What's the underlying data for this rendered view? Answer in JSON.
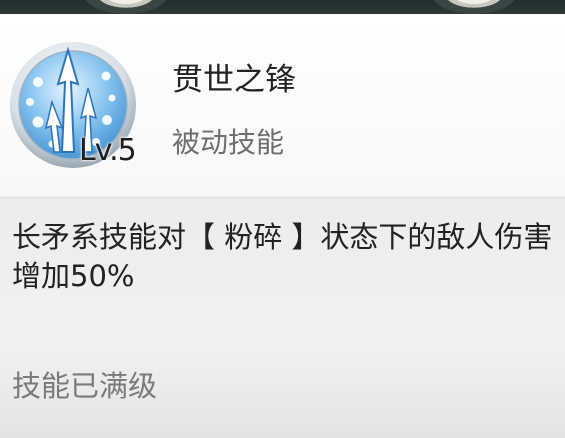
{
  "skill": {
    "icon": "spear-pierce-icon",
    "level_label": "Lv.5",
    "name": "贯世之锋",
    "type": "被动技能"
  },
  "description": {
    "text": "长矛系技能对【 粉碎 】状态下的敌人伤害\n增加50%"
  },
  "status": {
    "max_level_label": "技能已满级"
  },
  "colors": {
    "icon_rim": "#c9d3dc",
    "icon_fill": "#78b7e8",
    "panel_bg": "#ededed",
    "secondary_text": "#7a7a7a"
  }
}
